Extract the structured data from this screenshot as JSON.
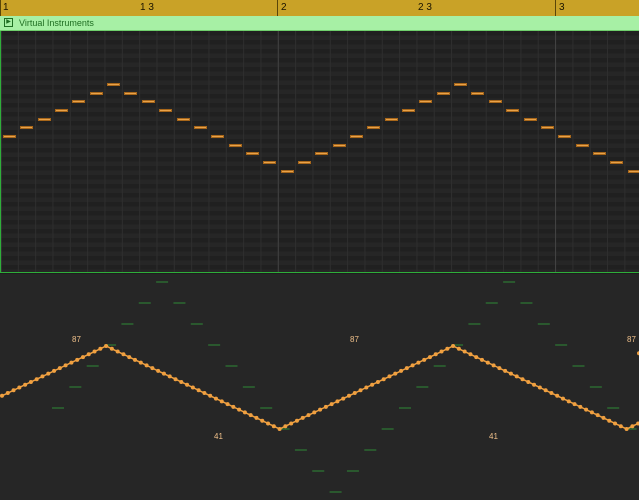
{
  "ruler": {
    "markers": [
      {
        "label": "1",
        "bar": true
      },
      {
        "label": "1 3",
        "bar": false
      },
      {
        "label": "2",
        "bar": true
      },
      {
        "label": "2 3",
        "bar": false
      },
      {
        "label": "3",
        "bar": true
      }
    ]
  },
  "region": {
    "name": "Virtual Instruments",
    "color": "#a7f0a5",
    "icon": "region-loop-icon"
  },
  "colors": {
    "ruler": "#c9a227",
    "note": "#e8a24a",
    "automation": "#f0a040",
    "grid_green": "#2fae3a"
  },
  "notes": {
    "pitch_rows": [
      9,
      8,
      7,
      6,
      5,
      4,
      3,
      4,
      5,
      6,
      7,
      8,
      9,
      10,
      11,
      12,
      13,
      12,
      11,
      10,
      9,
      8,
      7,
      6,
      5,
      4,
      3,
      4,
      5,
      6,
      7,
      8,
      9,
      10,
      11,
      12,
      13,
      12,
      11,
      10,
      9,
      8,
      7,
      6,
      5,
      4,
      3
    ]
  },
  "automation": {
    "peak_value": "87",
    "trough_value": "41",
    "peaks": [
      "87",
      "87",
      "87"
    ],
    "troughs": [
      "41",
      "41"
    ]
  }
}
